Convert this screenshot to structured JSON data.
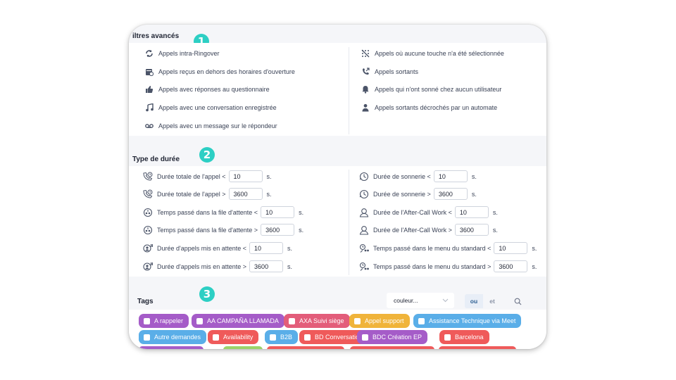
{
  "badges": [
    "1",
    "2",
    "3"
  ],
  "advanced": {
    "title": "iltres avancés",
    "left": [
      {
        "icon": "sync-icon",
        "label": "Appels intra-Ringover"
      },
      {
        "icon": "calendar-clock-icon",
        "label": "Appels reçus en dehors des horaires d'ouverture"
      },
      {
        "icon": "thumbs-up-icon",
        "label": "Appels avec réponses au questionnaire"
      },
      {
        "icon": "music-note-icon",
        "label": "Appels avec une conversation enregistrée"
      },
      {
        "icon": "voicemail-icon",
        "label": "Appels avec un message sur le répondeur"
      }
    ],
    "right": [
      {
        "icon": "no-keypad-icon",
        "label": "Appels où aucune touche n'a été sélectionnée"
      },
      {
        "icon": "outgoing-call-icon",
        "label": "Appels sortants"
      },
      {
        "icon": "bell-icon",
        "label": "Appels qui n'ont sonné chez aucun utilisateur"
      },
      {
        "icon": "user-icon",
        "label": "Appels sortants décrochés par un automate"
      }
    ]
  },
  "duration": {
    "title": "Type de durée",
    "unit": "s.",
    "left": [
      {
        "icon": "phone-clock-icon",
        "label": "Durée totale de l'appel <",
        "value": "10"
      },
      {
        "icon": "phone-clock-icon",
        "label": "Durée totale de l'appel >",
        "value": "3600"
      },
      {
        "icon": "queue-clock-icon",
        "label": "Temps passé dans la file d'attente <",
        "value": "10"
      },
      {
        "icon": "queue-clock-icon",
        "label": "Temps passé dans la file d'attente >",
        "value": "3600"
      },
      {
        "icon": "hold-icon",
        "label": "Durée d'appels mis en attente <",
        "value": "10"
      },
      {
        "icon": "hold-icon",
        "label": "Durée d'appels mis en attente >",
        "value": "3600"
      }
    ],
    "right": [
      {
        "icon": "ringing-clock-icon",
        "label": "Durée de sonnerie <",
        "value": "10"
      },
      {
        "icon": "ringing-clock-icon",
        "label": "Durée de sonnerie >",
        "value": "3600"
      },
      {
        "icon": "after-call-work-icon",
        "label": "Durée de l'After-Call Work <",
        "value": "10"
      },
      {
        "icon": "after-call-work-icon",
        "label": "Durée de l'After-Call Work >",
        "value": "3600"
      },
      {
        "icon": "ivr-menu-icon",
        "label": "Temps passé dans le menu du standard <",
        "value": "10"
      },
      {
        "icon": "ivr-menu-icon",
        "label": "Temps passé dans le menu du standard >",
        "value": "3600"
      }
    ]
  },
  "tags": {
    "title": "Tags",
    "color_select": "couleur...",
    "toggle_or": "ou",
    "toggle_and": "et",
    "row1": [
      {
        "label": "A rappeler",
        "color": "#a55cc8"
      },
      {
        "label": "AA CAMPAÑA LLAMADA",
        "color": "#a55cc8"
      },
      {
        "label": "AXA Suivi siège",
        "color": "#e35d7a"
      },
      {
        "label": "Appel support",
        "color": "#f0b43a"
      },
      {
        "label": "Assistance Technique via Meet",
        "color": "#5aaee8"
      }
    ],
    "row2": [
      {
        "label": "Autre demandes",
        "color": "#5aaee8"
      },
      {
        "label": "Availability",
        "color": "#ef5a5a"
      },
      {
        "label": "B2B",
        "color": "#5aaee8"
      },
      {
        "label": "BD Conversation",
        "color": "#ef5a5a"
      },
      {
        "label": "BDC Création EP",
        "color": "#a55cc8"
      },
      {
        "label": "Barcelona",
        "color": "#ef5a5a"
      }
    ]
  },
  "colors": {
    "accent": "#2dcfc4",
    "toggle_active_bg": "#e8eef7",
    "toggle_active_text": "#2e5f93"
  }
}
